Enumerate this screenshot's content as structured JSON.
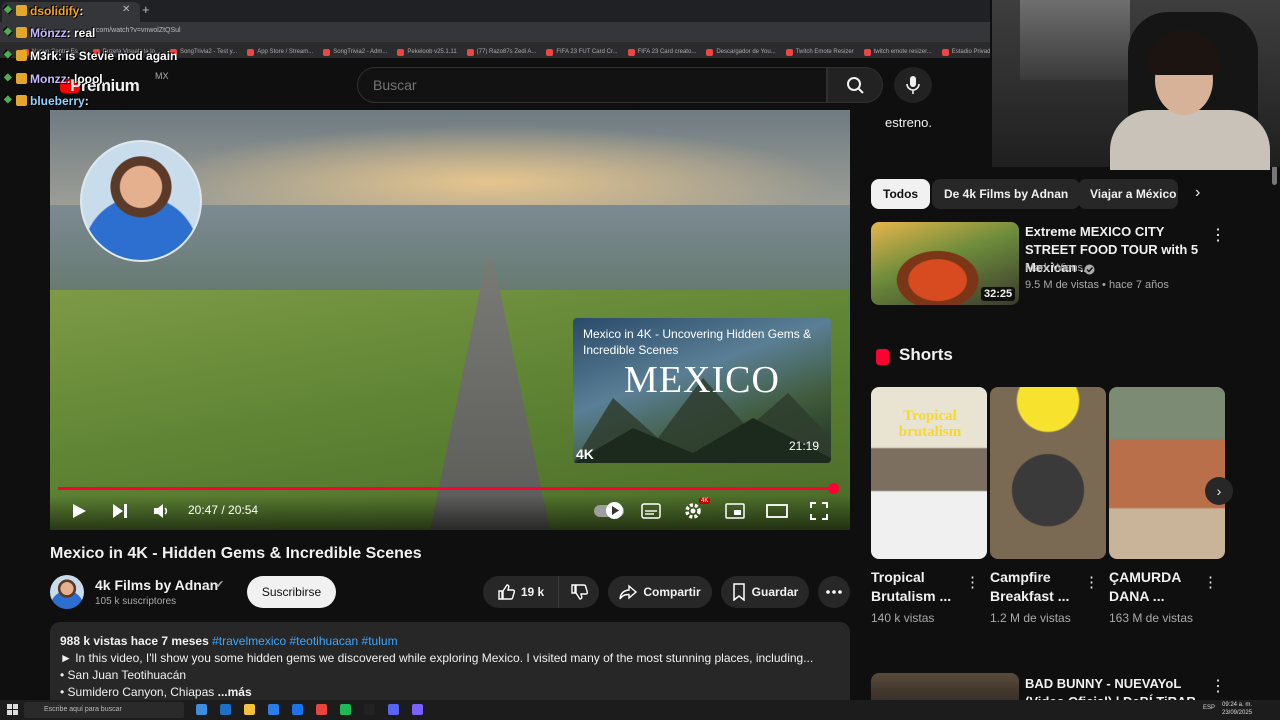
{
  "browser": {
    "tab_title": "dsolidify : ",
    "tab_close": "✕",
    "new_tab": "+",
    "url": "com/watch?v=vnwolZtQSul",
    "bookmarks": [
      "Nuevo Centro Es...",
      "Buzeta Visuals la lo...",
      "SongTrivia2 - Test y...",
      "App Store / Stream...",
      "SongTrivia2 - Adm...",
      "Pekeloob v25.1.11",
      "(77) Razo87s Zedi A...",
      "FIFA 23 FUT Card Cr...",
      "FIFA 23 Card creato...",
      "Descargador de You...",
      "Twitch Emote Resizer",
      "twitch emote resizer...",
      "Estadio Privado"
    ]
  },
  "chat": [
    {
      "user": "dsolidify",
      "msg": ": ",
      "color": "#f6a623"
    },
    {
      "user": "Mönzz",
      "msg": ": real",
      "color": "#c9b8ff"
    },
    {
      "user": "M3rk",
      "msg": ": is Stevie mod again",
      "color": "#ffffff"
    },
    {
      "user": "Monzz",
      "msg": ": loool",
      "color": "#c9b8ff"
    },
    {
      "user": "blueberry",
      "msg": ": ",
      "color": "#8fd3ff"
    }
  ],
  "header": {
    "logo": "Premium",
    "region": "MX",
    "search_placeholder": "Buscar"
  },
  "player": {
    "endcard_title": "Mexico in 4K - Uncovering Hidden Gems & Incredible Scenes",
    "endcard_word": "MEXICO",
    "endcard_badge": "4K",
    "endcard_duration": "21:19",
    "time": "20:47 / 20:54",
    "progress": 0.994,
    "hd_badge": "4K"
  },
  "video": {
    "title": "Mexico in 4K - Hidden Gems & Incredible Scenes",
    "channel": "4k Films by Adnan",
    "subscribers": "105 k suscriptores",
    "subscribe_label": "Suscribirse",
    "likes": "19 k",
    "share_label": "Compartir",
    "save_label": "Guardar",
    "desc_meta": "988 k vistas  hace 7 meses ",
    "desc_tags": "#travelmexico #teotihuacan #tulum",
    "desc_lines": [
      "► In this video, I'll show you some hidden gems we discovered while exploring Mexico. I visited many of the most stunning places, including...",
      "• San Juan Teotihuacán",
      "• Sumidero Canyon, Chiapas"
    ],
    "desc_more": " ...más"
  },
  "sidebar": {
    "estreno": "estreno.",
    "chips": [
      "Todos",
      "De 4k Films by Adnan",
      "Viajar a México"
    ],
    "rec": {
      "title": "Extreme MEXICO CITY STREET FOOD TOUR with 5 Mexican ...",
      "channel": "Mark Wiens",
      "meta": "9.5 M de vistas • hace 7 años",
      "duration": "32:25"
    },
    "shorts_label": "Shorts",
    "shorts": [
      {
        "title": "Tropical Brutalism ...",
        "views": "140 k vistas",
        "overlay": "Tropical brutalism"
      },
      {
        "title": "Campfire Breakfast ...",
        "views": "1.2 M de vistas"
      },
      {
        "title": "ÇAMURDA DANA ...",
        "views": "163 M de vistas"
      }
    ],
    "rec2": {
      "title": "BAD BUNNY - NUEVAYoL (Video Oficial) | DeBÍ TiRAR MáS..."
    }
  },
  "taskbar": {
    "search_placeholder": "Escribe aquí para buscar",
    "lang": "ESP",
    "clock_time": "09:24 a. m.",
    "clock_date": "23/09/2025"
  },
  "colors": {
    "accent": "#ff0033",
    "background": "#0f0f0f",
    "link": "#3ea6ff"
  }
}
